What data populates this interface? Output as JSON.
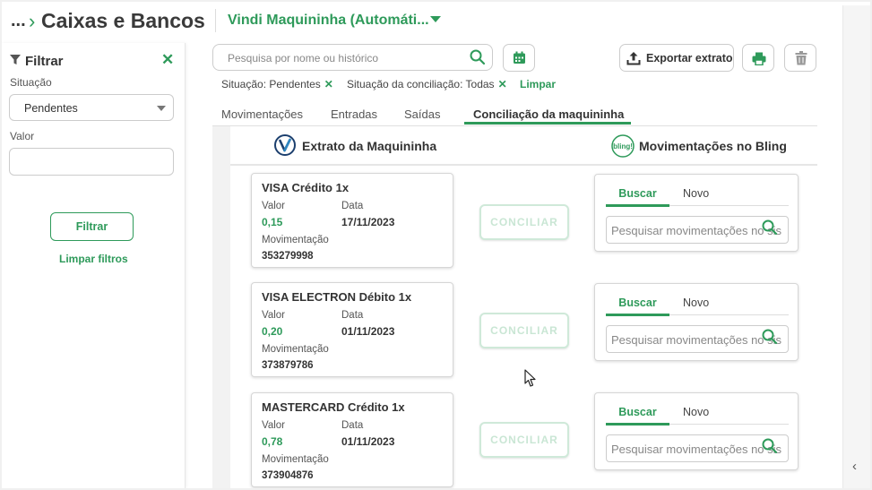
{
  "header": {
    "breadcrumb_dots": "...",
    "breadcrumb_chevron": "›",
    "title": "Caixas e Bancos",
    "account": "Vindi Maquininha (Automáti..."
  },
  "sidebar": {
    "title": "Filtrar",
    "close_icon": "✕",
    "situacao_label": "Situação",
    "situacao_value": "Pendentes",
    "valor_label": "Valor",
    "valor_value": "",
    "filter_button": "Filtrar",
    "clear_link": "Limpar filtros"
  },
  "toolbar": {
    "search_placeholder": "Pesquisa por nome ou histórico",
    "export_label": "Exportar extrato"
  },
  "chips": {
    "situacao": "Situação: Pendentes",
    "conciliacao": "Situação da conciliação: Todas",
    "remove_icon": "✕",
    "clear": "Limpar"
  },
  "tabs": [
    "Movimentações",
    "Entradas",
    "Saídas",
    "Conciliação da maquininha"
  ],
  "columns": {
    "left": "Extrato da Maquininha",
    "right": "Movimentações no Bling",
    "bling_logo": "bling!"
  },
  "labels": {
    "valor": "Valor",
    "data": "Data",
    "movimentacao": "Movimentação",
    "conciliar": "CONCILIAR",
    "buscar": "Buscar",
    "novo": "Novo",
    "search_mov_placeholder": "Pesquisar movimentações no sis"
  },
  "rows": [
    {
      "title": "VISA Crédito 1x",
      "valor": "0,15",
      "data": "17/11/2023",
      "movimentacao": "353279998"
    },
    {
      "title": "VISA ELECTRON Débito 1x",
      "valor": "0,20",
      "data": "01/11/2023",
      "movimentacao": "373879786"
    },
    {
      "title": "MASTERCARD Crédito 1x",
      "valor": "0,78",
      "data": "01/11/2023",
      "movimentacao": "373904876"
    }
  ],
  "colors": {
    "accent": "#2e9a5a",
    "conciliar_disabled": "#c9e6d4"
  },
  "icons": [
    "filter-icon",
    "close-icon",
    "search-icon",
    "calendar-icon",
    "upload-icon",
    "print-icon",
    "trash-icon",
    "vindi-logo-icon",
    "bling-logo-icon",
    "chevron-left-icon"
  ]
}
